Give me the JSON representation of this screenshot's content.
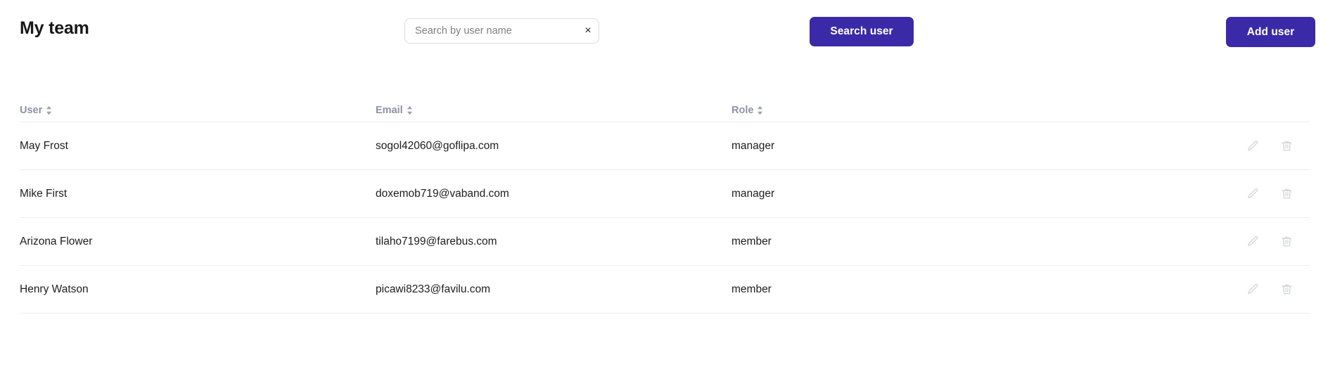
{
  "header": {
    "title": "My team",
    "search": {
      "placeholder": "Search by user name",
      "value": "",
      "clear_icon": "close-icon",
      "clear_glyph": "×"
    },
    "search_button_label": "Search user",
    "add_button_label": "Add user",
    "accent_color": "#3a2aa8"
  },
  "table": {
    "columns": [
      {
        "key": "user",
        "label": "User",
        "sortable": true,
        "sort_icon": "sort-updown-icon"
      },
      {
        "key": "email",
        "label": "Email",
        "sortable": true,
        "sort_icon": "sort-updown-icon"
      },
      {
        "key": "role",
        "label": "Role",
        "sortable": true,
        "sort_icon": "sort-updown-icon"
      }
    ],
    "row_actions": [
      {
        "name": "edit-icon",
        "label": "Edit"
      },
      {
        "name": "delete-icon",
        "label": "Delete"
      }
    ],
    "rows": [
      {
        "user": "May Frost",
        "email": "sogol42060@goflipa.com",
        "role": "manager"
      },
      {
        "user": "Mike First",
        "email": "doxemob719@vaband.com",
        "role": "manager"
      },
      {
        "user": "Arizona Flower",
        "email": "tilaho7199@farebus.com",
        "role": "member"
      },
      {
        "user": "Henry Watson",
        "email": "picawi8233@favilu.com",
        "role": "member"
      }
    ]
  }
}
